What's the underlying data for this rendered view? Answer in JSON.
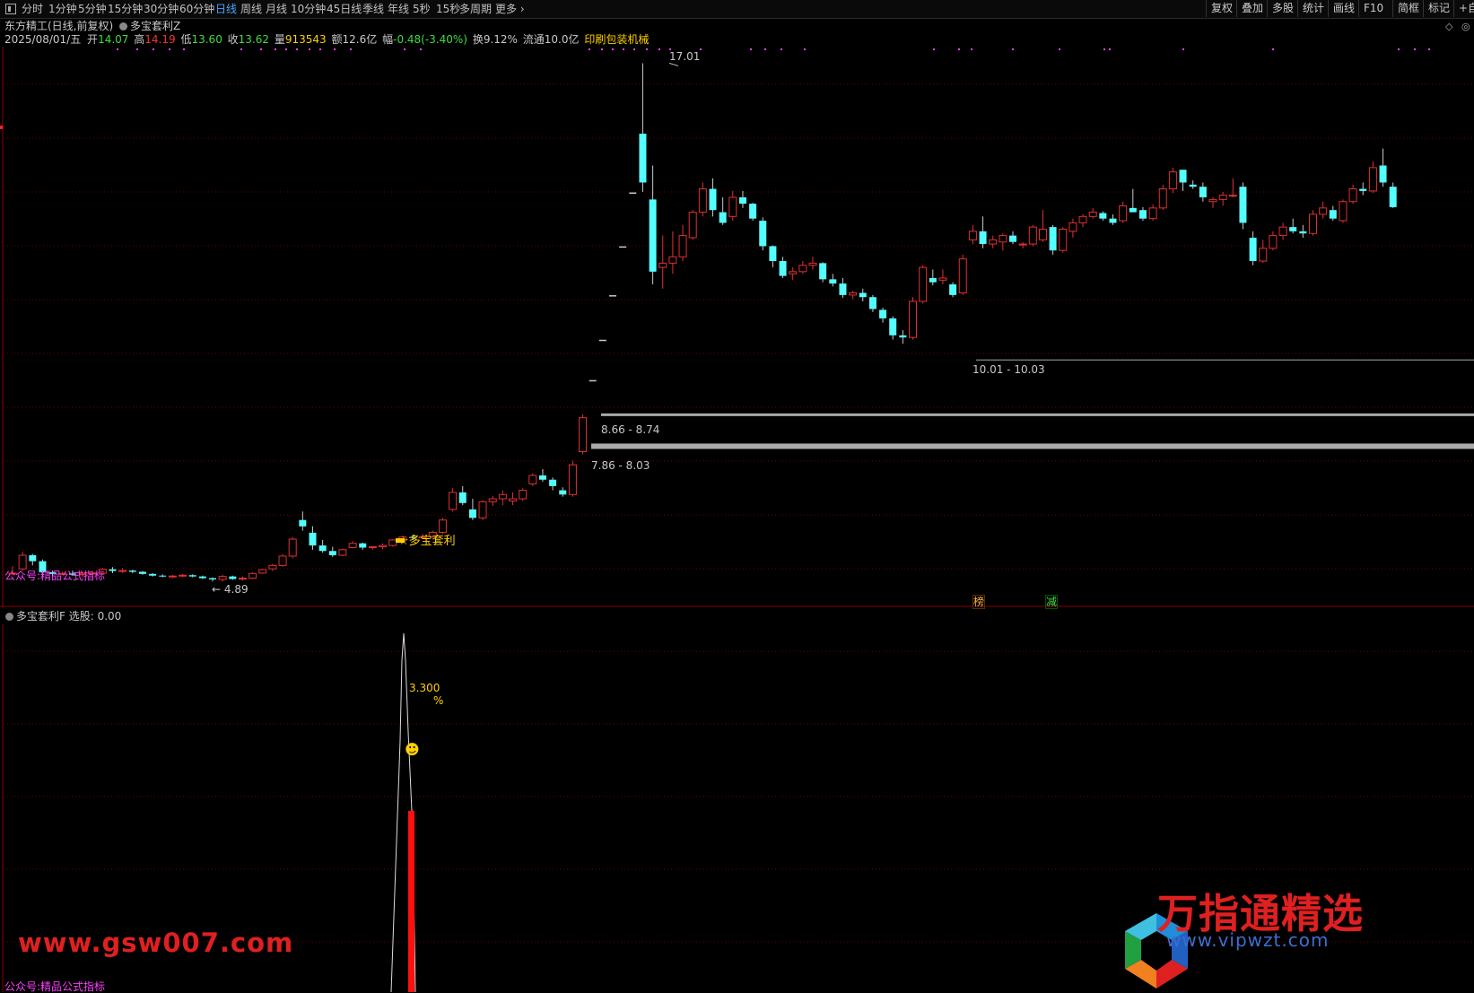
{
  "toolbar": {
    "periods": [
      "分时",
      "1分钟",
      "5分钟",
      "15分钟",
      "30分钟",
      "60分钟",
      "日线",
      "周线",
      "月线",
      "10分钟",
      "45日线",
      "季线",
      "年线",
      "5秒",
      "15秒",
      "多周期",
      "更多"
    ],
    "active_period": "日线",
    "right_buttons": [
      "复权",
      "叠加",
      "多股",
      "统计",
      "画线",
      "F10",
      "简框",
      "标记"
    ],
    "extra": "+自"
  },
  "header": {
    "title": "东方精工(日线,前复权)",
    "indicator": "多宝套利Z",
    "date": "2025/08/01/五",
    "open_label": "开",
    "open": "14.07",
    "high_label": "高",
    "high": "14.19",
    "low_label": "低",
    "low": "13.60",
    "close_label": "收",
    "close": "13.62",
    "vol_label": "量",
    "vol": "913543",
    "amount_label": "额",
    "amount": "12.6亿",
    "change_label": "幅",
    "change": "-0.48(-3.40%)",
    "turnover": "换9.12%",
    "float_cap": "流通10.0亿",
    "industry": "印刷包装机械"
  },
  "annotations": {
    "peak": "17.01",
    "low": "4.89",
    "zone_top": "10.01 - 10.03",
    "zone_mid": "8.66 - 8.74",
    "zone_low": "7.86 - 8.03",
    "signal": "☆多宝套利",
    "watermark_main": "公众号:精品公式指标",
    "badge1": "榜",
    "badge2": "减"
  },
  "sub_panel": {
    "title": "多宝套利F",
    "label": "选股: 0.00",
    "peak_value": "3.300",
    "pct": "%",
    "watermark": "公众号:精品公式指标"
  },
  "watermarks": {
    "left": "www.gsw007.com",
    "right": "万指通精选",
    "url": "www.vipwzt.com"
  },
  "colors": {
    "up": "#e03030",
    "down": "#54ffff",
    "magenta": "#ff40ff",
    "yellow": "#ffd000",
    "grid": "#6a0000"
  },
  "chart_data": {
    "type": "candlestick",
    "title": "东方精工(日线,前复权)",
    "candles": [
      [
        4.99,
        5.16,
        4.96,
        5.0
      ],
      [
        5.1,
        5.5,
        5.05,
        5.42
      ],
      [
        5.42,
        5.45,
        5.18,
        5.28
      ],
      [
        5.28,
        5.32,
        4.95,
        5.02
      ],
      [
        5.02,
        5.06,
        4.92,
        4.98
      ],
      [
        4.98,
        5.04,
        4.95,
        4.99
      ],
      [
        4.99,
        5.06,
        4.93,
        4.96
      ],
      [
        4.96,
        5.03,
        4.9,
        4.98
      ],
      [
        4.98,
        5.05,
        4.92,
        5.0
      ],
      [
        5.0,
        5.12,
        4.98,
        5.09
      ],
      [
        5.09,
        5.14,
        5.0,
        5.05
      ],
      [
        5.05,
        5.12,
        5.0,
        5.06
      ],
      [
        5.06,
        5.08,
        5.0,
        5.03
      ],
      [
        5.03,
        5.05,
        4.96,
        4.98
      ],
      [
        4.98,
        5.0,
        4.92,
        4.94
      ],
      [
        4.94,
        4.97,
        4.9,
        4.92
      ],
      [
        4.92,
        4.96,
        4.88,
        4.93
      ],
      [
        4.93,
        4.98,
        4.9,
        4.95
      ],
      [
        4.95,
        4.97,
        4.9,
        4.92
      ],
      [
        4.92,
        4.94,
        4.86,
        4.88
      ],
      [
        4.88,
        4.9,
        4.8,
        4.85
      ],
      [
        4.85,
        4.96,
        4.8,
        4.92
      ],
      [
        4.92,
        4.94,
        4.84,
        4.86
      ],
      [
        4.86,
        4.92,
        4.82,
        4.88
      ],
      [
        4.88,
        5.02,
        4.86,
        4.99
      ],
      [
        5.0,
        5.1,
        4.98,
        5.08
      ],
      [
        5.1,
        5.22,
        5.05,
        5.18
      ],
      [
        5.18,
        5.45,
        5.15,
        5.4
      ],
      [
        5.4,
        5.85,
        5.35,
        5.8
      ],
      [
        6.25,
        6.45,
        6.0,
        6.1
      ],
      [
        5.95,
        6.1,
        5.55,
        5.65
      ],
      [
        5.65,
        5.78,
        5.48,
        5.52
      ],
      [
        5.52,
        5.62,
        5.38,
        5.42
      ],
      [
        5.42,
        5.58,
        5.4,
        5.55
      ],
      [
        5.6,
        5.75,
        5.58,
        5.7
      ],
      [
        5.7,
        5.72,
        5.55,
        5.6
      ],
      [
        5.6,
        5.63,
        5.55,
        5.62
      ],
      [
        5.62,
        5.7,
        5.56,
        5.65
      ],
      [
        5.65,
        5.8,
        5.62,
        5.78
      ],
      [
        5.78,
        5.88,
        5.72,
        5.85
      ],
      [
        5.85,
        5.9,
        5.78,
        5.83
      ],
      [
        5.83,
        5.92,
        5.8,
        5.86
      ],
      [
        5.86,
        6.0,
        5.82,
        5.96
      ],
      [
        5.96,
        6.3,
        5.92,
        6.25
      ],
      [
        6.5,
        7.0,
        6.45,
        6.9
      ],
      [
        6.9,
        7.05,
        6.6,
        6.65
      ],
      [
        6.5,
        6.75,
        6.25,
        6.3
      ],
      [
        6.3,
        6.72,
        6.25,
        6.68
      ],
      [
        6.68,
        6.82,
        6.58,
        6.75
      ],
      [
        6.75,
        6.95,
        6.6,
        6.85
      ],
      [
        6.7,
        6.9,
        6.6,
        6.75
      ],
      [
        6.75,
        7.0,
        6.7,
        6.95
      ],
      [
        7.1,
        7.35,
        7.05,
        7.3
      ],
      [
        7.3,
        7.45,
        7.15,
        7.2
      ],
      [
        7.2,
        7.25,
        6.95,
        7.05
      ],
      [
        6.95,
        7.02,
        6.8,
        6.85
      ],
      [
        6.85,
        7.65,
        6.8,
        7.55
      ],
      [
        7.86,
        8.74,
        7.8,
        8.66
      ],
      [
        9.53,
        9.53,
        9.53,
        9.53
      ],
      [
        10.48,
        10.48,
        10.48,
        10.48
      ],
      [
        11.53,
        11.53,
        11.53,
        11.53
      ],
      [
        12.68,
        12.68,
        12.68,
        12.68
      ],
      [
        13.95,
        13.95,
        13.95,
        13.95
      ],
      [
        15.35,
        17.01,
        13.98,
        14.2
      ],
      [
        13.8,
        14.6,
        11.8,
        12.1
      ],
      [
        12.2,
        12.95,
        11.7,
        12.3
      ],
      [
        12.3,
        13.05,
        12.05,
        12.45
      ],
      [
        12.45,
        13.2,
        12.35,
        12.95
      ],
      [
        12.9,
        13.55,
        12.85,
        13.5
      ],
      [
        13.5,
        14.2,
        13.4,
        14.05
      ],
      [
        14.05,
        14.3,
        13.4,
        13.55
      ],
      [
        13.5,
        13.85,
        13.2,
        13.25
      ],
      [
        13.4,
        14.0,
        13.3,
        13.85
      ],
      [
        13.85,
        14.0,
        13.6,
        13.7
      ],
      [
        13.7,
        13.72,
        13.3,
        13.35
      ],
      [
        13.3,
        13.38,
        12.6,
        12.7
      ],
      [
        12.7,
        12.72,
        12.2,
        12.35
      ],
      [
        12.35,
        12.45,
        11.95,
        12.0
      ],
      [
        12.05,
        12.2,
        11.9,
        12.1
      ],
      [
        12.1,
        12.35,
        12.05,
        12.25
      ],
      [
        12.25,
        12.45,
        12.15,
        12.3
      ],
      [
        12.3,
        12.32,
        11.85,
        11.92
      ],
      [
        11.92,
        12.05,
        11.75,
        11.82
      ],
      [
        11.82,
        11.95,
        11.48,
        11.55
      ],
      [
        11.55,
        11.65,
        11.45,
        11.6
      ],
      [
        11.6,
        11.7,
        11.4,
        11.5
      ],
      [
        11.5,
        11.55,
        11.15,
        11.22
      ],
      [
        11.2,
        11.25,
        10.9,
        11.0
      ],
      [
        11.0,
        11.05,
        10.5,
        10.6
      ],
      [
        10.6,
        10.72,
        10.4,
        10.55
      ],
      [
        10.55,
        11.5,
        10.5,
        11.4
      ],
      [
        11.4,
        12.25,
        11.35,
        12.2
      ],
      [
        11.95,
        12.15,
        11.78,
        11.85
      ],
      [
        11.9,
        12.15,
        11.8,
        11.95
      ],
      [
        11.8,
        11.85,
        11.5,
        11.55
      ],
      [
        11.6,
        12.5,
        11.55,
        12.4
      ],
      [
        12.85,
        13.2,
        12.75,
        13.05
      ],
      [
        13.05,
        13.4,
        12.65,
        12.75
      ],
      [
        12.75,
        12.95,
        12.65,
        12.85
      ],
      [
        12.8,
        13.0,
        12.6,
        12.95
      ],
      [
        12.95,
        13.05,
        12.75,
        12.8
      ],
      [
        12.75,
        12.8,
        12.65,
        12.75
      ],
      [
        12.75,
        13.2,
        12.7,
        13.15
      ],
      [
        12.85,
        13.55,
        12.8,
        13.1
      ],
      [
        13.15,
        13.2,
        12.5,
        12.6
      ],
      [
        12.6,
        13.15,
        12.55,
        13.1
      ],
      [
        13.05,
        13.35,
        12.9,
        13.25
      ],
      [
        13.25,
        13.45,
        13.15,
        13.4
      ],
      [
        13.4,
        13.6,
        13.35,
        13.5
      ],
      [
        13.48,
        13.52,
        13.3,
        13.35
      ],
      [
        13.35,
        13.45,
        13.2,
        13.25
      ],
      [
        13.3,
        13.75,
        13.25,
        13.65
      ],
      [
        13.6,
        14.05,
        13.5,
        13.5
      ],
      [
        13.55,
        13.62,
        13.3,
        13.35
      ],
      [
        13.35,
        13.68,
        13.3,
        13.6
      ],
      [
        13.6,
        14.15,
        13.55,
        14.05
      ],
      [
        14.05,
        14.55,
        13.95,
        14.45
      ],
      [
        14.5,
        14.5,
        14.0,
        14.2
      ],
      [
        14.15,
        14.25,
        14.05,
        14.1
      ],
      [
        14.1,
        14.2,
        13.75,
        13.85
      ],
      [
        13.75,
        13.85,
        13.6,
        13.8
      ],
      [
        13.8,
        13.98,
        13.65,
        13.9
      ],
      [
        13.9,
        14.3,
        13.85,
        13.9
      ],
      [
        14.1,
        14.2,
        13.1,
        13.25
      ],
      [
        12.9,
        13.05,
        12.25,
        12.35
      ],
      [
        12.35,
        12.85,
        12.3,
        12.65
      ],
      [
        12.65,
        13.05,
        12.6,
        12.95
      ],
      [
        12.95,
        13.25,
        12.85,
        13.15
      ],
      [
        13.15,
        13.35,
        13.0,
        13.05
      ],
      [
        13.05,
        13.2,
        12.9,
        13.0
      ],
      [
        13.0,
        13.55,
        12.95,
        13.45
      ],
      [
        13.45,
        13.75,
        13.35,
        13.6
      ],
      [
        13.55,
        13.65,
        13.3,
        13.35
      ],
      [
        13.3,
        13.8,
        13.25,
        13.75
      ],
      [
        13.75,
        14.15,
        13.7,
        14.05
      ],
      [
        14.05,
        14.2,
        13.9,
        14.0
      ],
      [
        14.0,
        14.7,
        13.95,
        14.55
      ],
      [
        14.6,
        15.0,
        14.1,
        14.2
      ],
      [
        14.1,
        14.2,
        13.6,
        13.62
      ]
    ],
    "ylim": [
      4.3,
      17.4
    ],
    "indicator_series": {
      "name": "多宝套利F",
      "peak": 3.3
    }
  }
}
